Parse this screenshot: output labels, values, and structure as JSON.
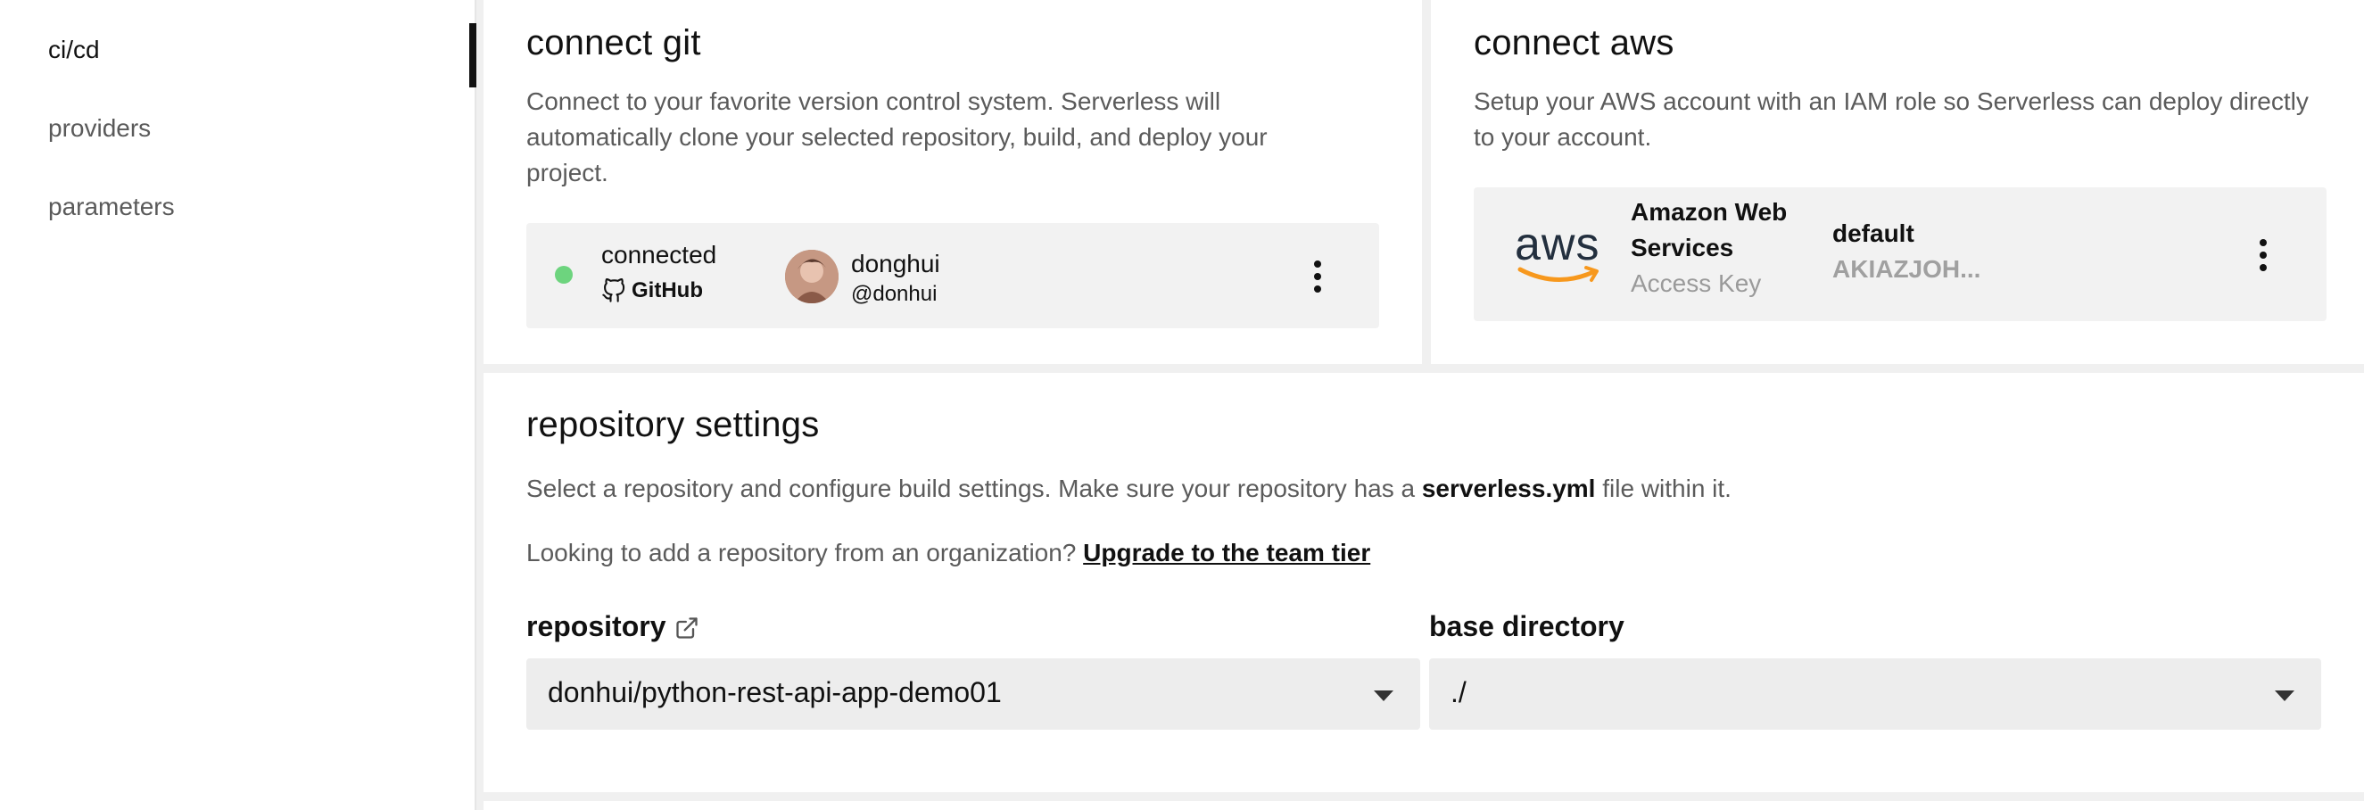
{
  "sidebar": {
    "items": [
      {
        "label": "ci/cd"
      },
      {
        "label": "providers"
      },
      {
        "label": "parameters"
      }
    ]
  },
  "git": {
    "title": "connect git",
    "description": "Connect to your favorite version control system. Serverless will automatically clone your selected repository, build, and deploy your project.",
    "status": "connected",
    "provider": "GitHub",
    "user_name": "donghui",
    "user_handle": "@donhui"
  },
  "aws": {
    "title": "connect aws",
    "description": "Setup your AWS account with an IAM role so Serverless can deploy directly to your account.",
    "logo_text": "aws",
    "service_line1": "Amazon Web",
    "service_line2": "Services",
    "service_sub": "Access Key",
    "profile": "default",
    "key": "AKIAZJOH..."
  },
  "repo": {
    "title": "repository settings",
    "desc_prefix": "Select a repository and configure build settings. Make sure your repository has a ",
    "desc_bold": "serverless.yml",
    "desc_suffix": " file within it.",
    "org_prefix": "Looking to add a repository from an organization? ",
    "org_link": "Upgrade to the team tier",
    "repository_label": "repository",
    "repository_value": "donhui/python-rest-api-app-demo01",
    "base_dir_label": "base directory",
    "base_dir_value": "./"
  },
  "colors": {
    "status_connected": "#6dd47e",
    "aws_smile": "#f7981d",
    "aws_text": "#232f3e"
  }
}
